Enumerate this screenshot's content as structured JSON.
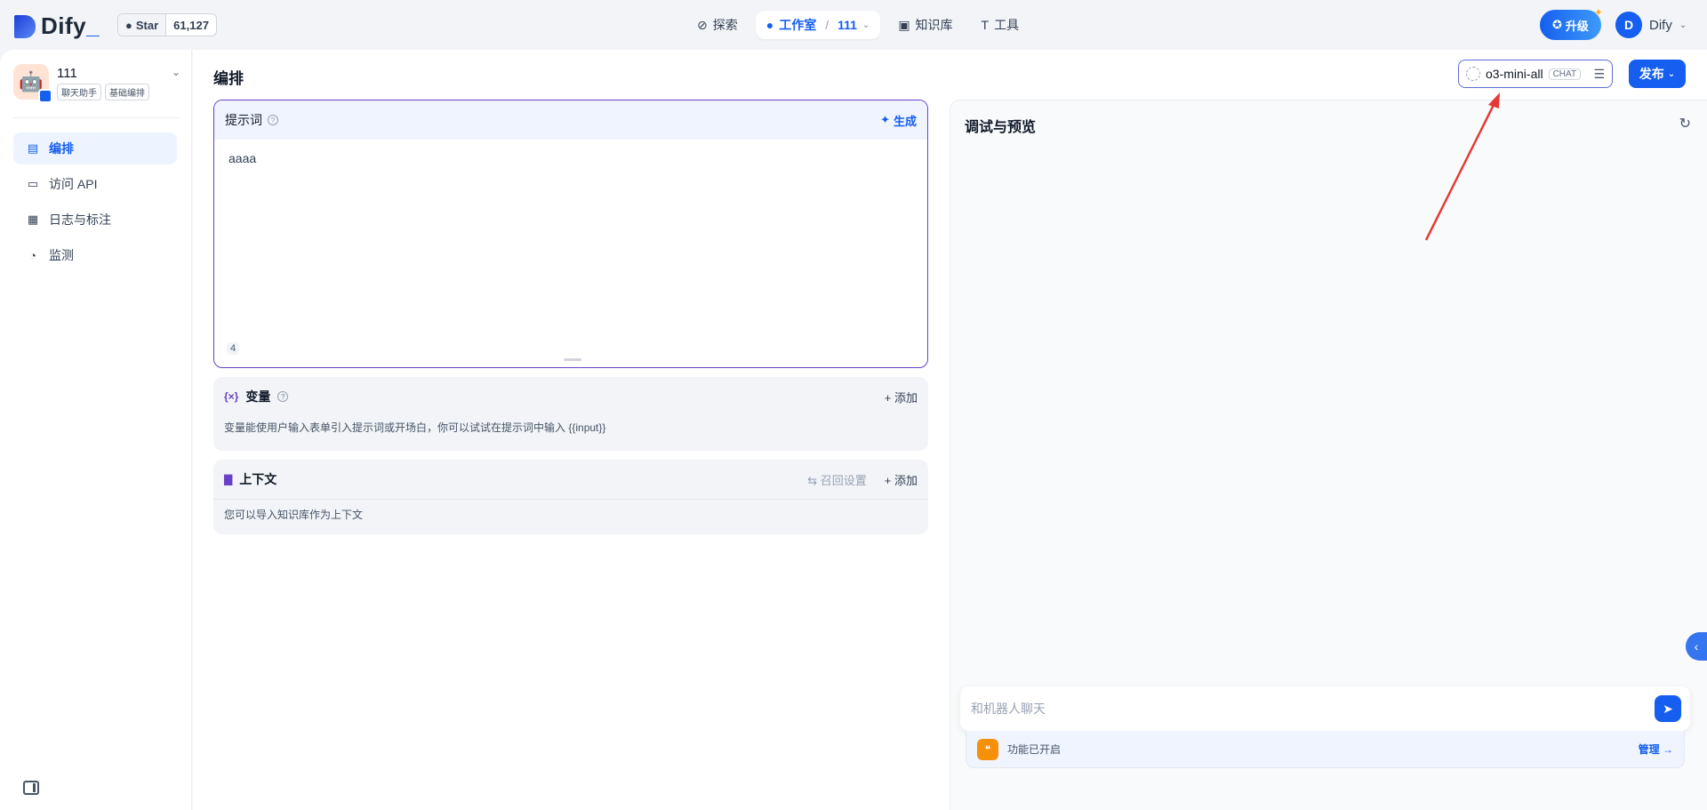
{
  "brand": {
    "name_main": "Dify",
    "name_suffix": "_"
  },
  "github": {
    "star_label": "Star",
    "count": "61,127"
  },
  "nav": {
    "explore": "探索",
    "studio": "工作室",
    "studio_app": "111",
    "knowledge": "知识库",
    "tools": "工具"
  },
  "header_right": {
    "upgrade": "升级",
    "user_initial": "D",
    "user_name": "Dify"
  },
  "app": {
    "name": "111",
    "tags": [
      "聊天助手",
      "基础编排"
    ]
  },
  "sidebar": {
    "items": [
      {
        "label": "编排",
        "icon": "layout-icon"
      },
      {
        "label": "访问 API",
        "icon": "terminal-icon"
      },
      {
        "label": "日志与标注",
        "icon": "file-list-icon"
      },
      {
        "label": "监测",
        "icon": "gauge-icon"
      }
    ]
  },
  "main": {
    "title": "编排",
    "model": {
      "name": "o3-mini-all",
      "mode": "CHAT"
    },
    "publish": "发布"
  },
  "prompt": {
    "title": "提示词",
    "generate": "生成",
    "content": "aaaa",
    "count": "4"
  },
  "variables": {
    "title": "变量",
    "add": "添加",
    "description": "变量能使用户输入表单引入提示词或开场白，你可以试试在提示词中输入 {{input}}"
  },
  "context": {
    "title": "上下文",
    "recall": "召回设置",
    "add": "添加",
    "description": "您可以导入知识库作为上下文"
  },
  "debug": {
    "title": "调试与预览",
    "placeholder": "和机器人聊天",
    "features_enabled": "功能已开启",
    "manage": "管理"
  },
  "colors": {
    "accent": "#155eef",
    "prompt_border": "#6941c6",
    "annotation": "#e53935"
  }
}
